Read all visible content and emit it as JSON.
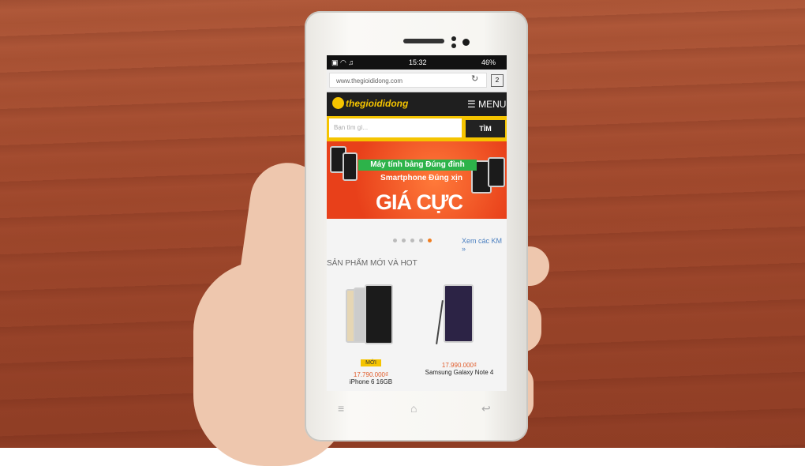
{
  "status": {
    "time": "15:32",
    "battery": "46%"
  },
  "browser": {
    "url": "www.thegioididong.com",
    "tabs_count": "2"
  },
  "site": {
    "logo": "thegioididong",
    "menu_label": "MENU"
  },
  "search": {
    "placeholder": "Bạn tìm gì...",
    "button": "TÌM"
  },
  "banner": {
    "line1": "Máy tính bảng Đúng đỉnh",
    "line2": "Smartphone Đúng xịn",
    "line3": "GIÁ CỰC NGON"
  },
  "links": {
    "see_promo": "Xem các KM »"
  },
  "section": {
    "title": "SẢN PHẨM MỚI VÀ HOT"
  },
  "products": [
    {
      "badge": "MỚI",
      "price": "17.790.000₫",
      "name": "iPhone 6 16GB"
    },
    {
      "price": "17.990.000₫",
      "name": "Samsung Galaxy Note 4"
    }
  ],
  "icons": {
    "reload": "reload-icon",
    "tabs": "tabs-icon",
    "menu": "hamburger-icon",
    "back": "back-icon",
    "home": "home-icon",
    "recents": "recents-icon"
  }
}
